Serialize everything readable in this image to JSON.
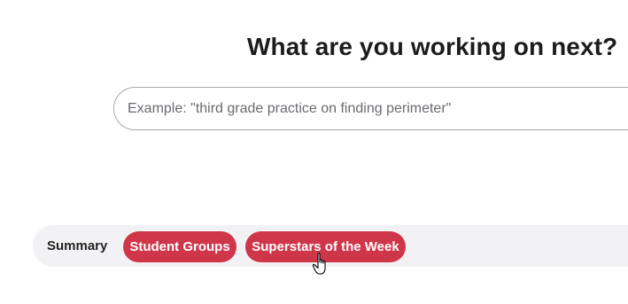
{
  "heading": "What are you working on next?",
  "search": {
    "placeholder": "Example: \"third grade practice on finding perimeter\"",
    "value": ""
  },
  "tabs": [
    {
      "label": "Summary",
      "active": false
    },
    {
      "label": "Student Groups",
      "active": true
    },
    {
      "label": "Superstars of the Week",
      "active": true
    }
  ],
  "colors": {
    "accent": "#d0364a",
    "tab_bar_bg": "#f2f2f4",
    "heading_text": "#1c1c1c",
    "input_border": "#a9a9ad"
  },
  "cursor_icon": "hand-pointer-icon"
}
